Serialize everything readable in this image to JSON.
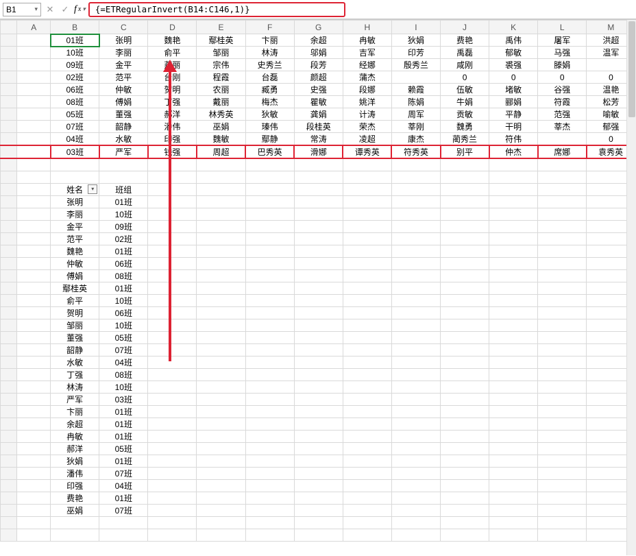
{
  "namebox": {
    "ref": "B1"
  },
  "formula": "{=ETRegularInvert(B14:C146,1)}",
  "columns": [
    "",
    "A",
    "B",
    "C",
    "D",
    "E",
    "F",
    "G",
    "H",
    "I",
    "J",
    "K",
    "L",
    "M"
  ],
  "top_table": [
    [
      "01班",
      "张明",
      "魏艳",
      "鄢桂英",
      "卞丽",
      "余超",
      "冉敏",
      "狄娟",
      "费艳",
      "禹伟",
      "屠军",
      "洪超"
    ],
    [
      "10班",
      "李丽",
      "俞平",
      "邹丽",
      "林涛",
      "邬娟",
      "吉军",
      "印芳",
      "禹磊",
      "郁敏",
      "马强",
      "温军"
    ],
    [
      "09班",
      "金平",
      "燕丽",
      "宗伟",
      "史秀兰",
      "段芳",
      "经娜",
      "殷秀兰",
      "咸刚",
      "裘强",
      "滕娟",
      ""
    ],
    [
      "02班",
      "范平",
      "台刚",
      "程霞",
      "台磊",
      "颜超",
      "蒲杰",
      "",
      "0",
      "0",
      "0",
      "0"
    ],
    [
      "06班",
      "仲敏",
      "贺明",
      "农丽",
      "臧勇",
      "史强",
      "段娜",
      "赖霞",
      "伍敏",
      "堵敏",
      "谷强",
      "温艳"
    ],
    [
      "08班",
      "傅娟",
      "丁强",
      "戴丽",
      "梅杰",
      "瞿敏",
      "姚洋",
      "陈娟",
      "牛娟",
      "郦娟",
      "符霞",
      "松芳"
    ],
    [
      "05班",
      "董强",
      "郝洋",
      "林秀英",
      "狄敏",
      "龚娟",
      "计涛",
      "周军",
      "贡敏",
      "平静",
      "范强",
      "喻敏"
    ],
    [
      "07班",
      "韶静",
      "潘伟",
      "巫娟",
      "瑧伟",
      "段桂英",
      "荣杰",
      "莘刚",
      "魏勇",
      "干明",
      "莘杰",
      "郁强"
    ],
    [
      "04班",
      "水敏",
      "印强",
      "魏敏",
      "鄢静",
      "常涛",
      "凌超",
      "康杰",
      "蔺秀兰",
      "符伟",
      "",
      "0"
    ],
    [
      "03班",
      "严军",
      "钱强",
      "周超",
      "巴秀英",
      "滑娜",
      "谭秀英",
      "符秀英",
      "别平",
      "仲杰",
      "席娜",
      "袁秀英"
    ]
  ],
  "highlight_row_index": 9,
  "list_header": {
    "name": "姓名",
    "group": "班组"
  },
  "list": [
    {
      "name": "张明",
      "group": "01班"
    },
    {
      "name": "李丽",
      "group": "10班"
    },
    {
      "name": "金平",
      "group": "09班"
    },
    {
      "name": "范平",
      "group": "02班"
    },
    {
      "name": "魏艳",
      "group": "01班"
    },
    {
      "name": "仲敏",
      "group": "06班"
    },
    {
      "name": "傅娟",
      "group": "08班"
    },
    {
      "name": "鄢桂英",
      "group": "01班"
    },
    {
      "name": "俞平",
      "group": "10班"
    },
    {
      "name": "贺明",
      "group": "06班"
    },
    {
      "name": "邹丽",
      "group": "10班"
    },
    {
      "name": "董强",
      "group": "05班"
    },
    {
      "name": "韶静",
      "group": "07班"
    },
    {
      "name": "水敏",
      "group": "04班"
    },
    {
      "name": "丁强",
      "group": "08班"
    },
    {
      "name": "林涛",
      "group": "10班"
    },
    {
      "name": "严军",
      "group": "03班"
    },
    {
      "name": "卞丽",
      "group": "01班"
    },
    {
      "name": "余超",
      "group": "01班"
    },
    {
      "name": "冉敏",
      "group": "01班"
    },
    {
      "name": "郝洋",
      "group": "05班"
    },
    {
      "name": "狄娟",
      "group": "01班"
    },
    {
      "name": "潘伟",
      "group": "07班"
    },
    {
      "name": "印强",
      "group": "04班"
    },
    {
      "name": "费艳",
      "group": "01班"
    },
    {
      "name": "巫娟",
      "group": "07班"
    }
  ]
}
